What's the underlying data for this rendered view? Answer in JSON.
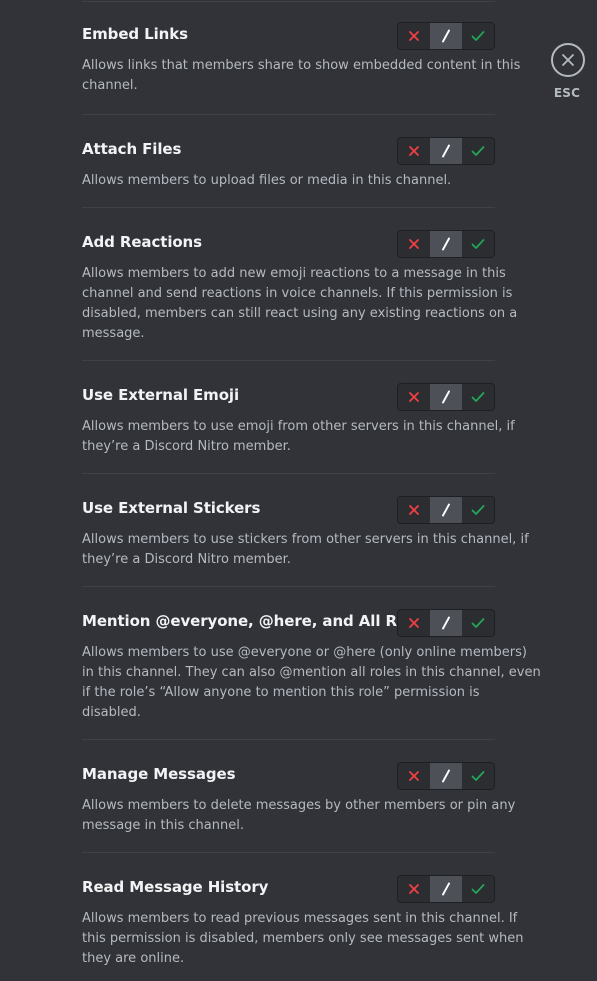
{
  "close": {
    "label": "ESC",
    "icon": "close-icon"
  },
  "permissions": [
    {
      "title": "Embed Links",
      "desc_lines": [
        "Allows links that members share to show embedded content in this",
        "channel."
      ]
    },
    {
      "title": "Attach Files",
      "desc_lines": [
        "Allows members to upload files or media in this channel."
      ]
    },
    {
      "title": "Add Reactions",
      "desc_lines": [
        "Allows members to add new emoji reactions to a message in this",
        "channel and send reactions in voice channels. If this permission is",
        "disabled, members can still react using any existing reactions on a",
        "message."
      ]
    },
    {
      "title": "Use External Emoji",
      "desc_lines": [
        "Allows members to use emoji from other servers in this channel, if",
        "they’re a Discord Nitro member."
      ]
    },
    {
      "title": "Use External Stickers",
      "desc_lines": [
        "Allows members to use stickers from other servers in this channel, if",
        "they’re a Discord Nitro member."
      ]
    },
    {
      "title": "Mention @everyone, @here, and All Roles",
      "desc_lines": [
        "Allows members to use @everyone or @here (only online members)",
        "in this channel. They can also @mention all roles in this channel, even",
        "if the role’s “Allow anyone to mention this role” permission is",
        "disabled."
      ]
    },
    {
      "title": "Manage Messages",
      "desc_lines": [
        "Allows members to delete messages by other members or pin any",
        "message in this channel."
      ]
    },
    {
      "title": "Read Message History",
      "desc_lines": [
        "Allows members to read previous messages sent in this channel. If",
        "this permission is disabled, members only see messages sent when",
        "they are online."
      ]
    }
  ],
  "toggle": {
    "options": [
      "deny",
      "inherit",
      "allow"
    ],
    "selected": "inherit",
    "icons": [
      "x-icon",
      "slash-icon",
      "check-icon"
    ]
  },
  "colors": {
    "background": "#313338",
    "deny": "#f23f43",
    "allow": "#23a55a",
    "neutral": "#ffffff"
  }
}
